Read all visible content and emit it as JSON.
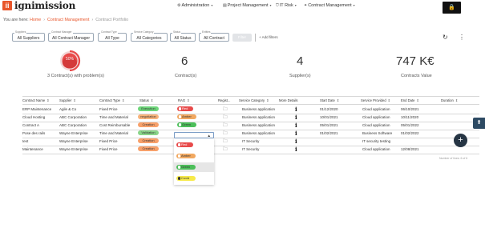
{
  "app": {
    "logo_letters": "ii",
    "name": "ignimission"
  },
  "nav": {
    "items": [
      {
        "icon": "settings-icon",
        "label": "Administration"
      },
      {
        "icon": "document-icon",
        "label": "Project Management"
      },
      {
        "icon": "shield-icon",
        "label": "IT Risk"
      },
      {
        "icon": "handshake-icon",
        "label": "Contract Management"
      }
    ],
    "lock_icon": "lock-icon"
  },
  "breadcrumb": {
    "prefix": "You are here:",
    "home": "Home",
    "section": "Contract Management",
    "current": "Contract Portfolio"
  },
  "filters": [
    {
      "label": "Suppliers",
      "value": "All Suppliers"
    },
    {
      "label": "Contract Manager",
      "value": "All Contract Manager"
    },
    {
      "label": "Contract Type",
      "value": "All Type"
    },
    {
      "label": "Service Category",
      "value": "All Categories"
    },
    {
      "label": "Status",
      "value": "All Status"
    },
    {
      "label": "Entities",
      "value": "All Contract"
    }
  ],
  "filter_button": "Filter",
  "add_filters": "Add filters",
  "kpis": {
    "gauge": {
      "value": "50%",
      "caption": "3 Contract(s) with problem(s)",
      "level": 0.5,
      "color": "#e84a4a"
    },
    "contracts": {
      "value": "6",
      "caption": "Contract(s)"
    },
    "suppliers": {
      "value": "4",
      "caption": "Supplier(s)"
    },
    "value": {
      "value": "747 K€",
      "caption": "Contracts Value"
    }
  },
  "table": {
    "columns": [
      "Contract Name",
      "Supplier",
      "Contract Type",
      "Status",
      "RAG",
      "Regist...",
      "Service Category",
      "More Details",
      "Start Date",
      "Service Provided",
      "End Date",
      "Duration"
    ],
    "rows": [
      {
        "name": "ERP Maintenance",
        "supplier": "Agile & Co",
        "type": "Fixed Price",
        "status": "Execution",
        "status_class": "st-exec",
        "rag": "Red",
        "rag_class": "rag-red",
        "service_category": "Business application",
        "start": "01/12/2020",
        "provided": "Cloud application",
        "end": "06/10/2021",
        "duration": ""
      },
      {
        "name": "Cloud Hosting",
        "supplier": "ABC Corporation",
        "type": "Time and Material",
        "status": "negotiation",
        "status_class": "st-nego",
        "rag": "Amber",
        "rag_class": "rag-amber",
        "service_category": "Business application",
        "start": "10/01/2021",
        "provided": "Cloud application",
        "end": "10/11/2020",
        "duration": ""
      },
      {
        "name": "Contract A",
        "supplier": "ABC Corporation",
        "type": "Cost Reimbursable",
        "status": "Creation",
        "status_class": "st-crea",
        "rag": "Green",
        "rag_class": "rag-green",
        "service_category": "Business application",
        "start": "05/01/2021",
        "provided": "Cloud application",
        "end": "05/01/2022",
        "duration": ""
      },
      {
        "name": "Pose des rails",
        "supplier": "Wayne Enterprise",
        "type": "Time and Material",
        "status": "Validation",
        "status_class": "st-vali",
        "rag": "",
        "rag_class": "",
        "service_category": "Business application",
        "start": "01/02/2021",
        "provided": "Business Software",
        "end": "01/02/2022",
        "duration": ""
      },
      {
        "name": "test",
        "supplier": "Wayne Enterprise",
        "type": "Fixed Price",
        "status": "Creation",
        "status_class": "st-crea",
        "rag": "",
        "rag_class": "",
        "service_category": "IT Security",
        "start": "",
        "provided": "IT security testing",
        "end": "",
        "duration": ""
      },
      {
        "name": "Maintenance",
        "supplier": "Wayne Enterprise",
        "type": "Fixed Price",
        "status": "Creation",
        "status_class": "st-crea",
        "rag": "",
        "rag_class": "",
        "service_category": "IT Security",
        "start": "",
        "provided": "Cloud application",
        "end": "12/08/2021",
        "duration": ""
      }
    ],
    "footer": "Number of lines: 6 of 6"
  },
  "rag_dropdown": {
    "options": [
      {
        "label": "Red",
        "class": "rag-red"
      },
      {
        "label": "Amber",
        "class": "rag-amber"
      },
      {
        "label": "Green",
        "class": "rag-green"
      },
      {
        "label": "Covid",
        "class": "rag-covid"
      }
    ],
    "highlighted_index": 2
  },
  "fab": {
    "icon": "plus-icon"
  },
  "side_tab": {
    "icon": "arrow-up-icon"
  }
}
